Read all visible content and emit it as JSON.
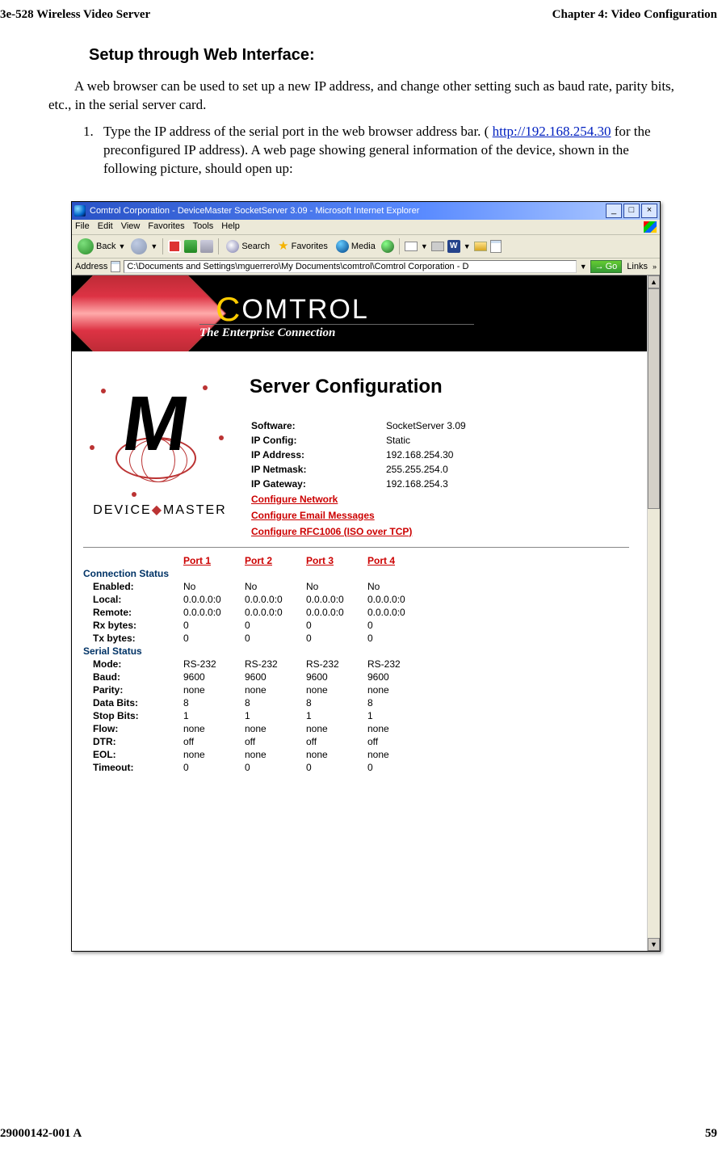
{
  "page_header": {
    "left": "3e-528 Wireless Video Server",
    "right": "Chapter 4: Video Configuration"
  },
  "section_heading": "Setup through Web Interface:",
  "intro_para": "A web browser can be used to set up a new IP address, and change other setting such as baud rate, parity bits, etc., in the serial server card.",
  "step_pre": "Type the IP address of the serial port in the web browser address bar. ( ",
  "step_link": "http://192.168.254.30",
  "step_post": " for the preconfigured IP address). A web page showing general information of the device, shown in the following picture, should open up:",
  "ie": {
    "title": "Comtrol Corporation - DeviceMaster SocketServer 3.09 - Microsoft Internet Explorer",
    "min": "_",
    "max": "□",
    "close": "×",
    "menu": [
      "File",
      "Edit",
      "View",
      "Favorites",
      "Tools",
      "Help"
    ],
    "back": "Back",
    "search": "Search",
    "favorites": "Favorites",
    "media": "Media",
    "addr_label": "Address",
    "addr_value": "C:\\Documents and Settings\\mguerrero\\My Documents\\comtrol\\Comtrol Corporation - D",
    "go": "Go",
    "links": "Links"
  },
  "banner": {
    "brand_c": "C",
    "brand_rest": "OMTROL",
    "tagline": "The Enterprise Connection"
  },
  "logo_text_1": "DEV",
  "logo_text_2": "CE",
  "logo_text_3": "MASTER",
  "cfg": {
    "title": "Server Configuration",
    "rows": [
      {
        "label": "Software:",
        "value": "SocketServer 3.09"
      },
      {
        "label": "IP Config:",
        "value": "Static"
      },
      {
        "label": "IP Address:",
        "value": "192.168.254.30"
      },
      {
        "label": "IP Netmask:",
        "value": "255.255.254.0"
      },
      {
        "label": "IP Gateway:",
        "value": "192.168.254.3"
      }
    ],
    "links": [
      "Configure Network",
      "Configure Email Messages",
      "Configure RFC1006 (ISO over TCP)"
    ]
  },
  "status": {
    "port_headers": [
      "Port 1",
      "Port 2",
      "Port 3",
      "Port 4"
    ],
    "conn_section": "Connection Status",
    "serial_section": "Serial Status",
    "rows": [
      {
        "section": "conn",
        "label": "Enabled:",
        "v": [
          "No",
          "No",
          "No",
          "No"
        ]
      },
      {
        "section": "conn",
        "label": "Local:",
        "v": [
          "0.0.0.0:0",
          "0.0.0.0:0",
          "0.0.0.0:0",
          "0.0.0.0:0"
        ]
      },
      {
        "section": "conn",
        "label": "Remote:",
        "v": [
          "0.0.0.0:0",
          "0.0.0.0:0",
          "0.0.0.0:0",
          "0.0.0.0:0"
        ]
      },
      {
        "section": "conn",
        "label": "Rx bytes:",
        "v": [
          "0",
          "0",
          "0",
          "0"
        ]
      },
      {
        "section": "conn",
        "label": "Tx bytes:",
        "v": [
          "0",
          "0",
          "0",
          "0"
        ]
      },
      {
        "section": "serial",
        "label": "Mode:",
        "v": [
          "RS-232",
          "RS-232",
          "RS-232",
          "RS-232"
        ]
      },
      {
        "section": "serial",
        "label": "Baud:",
        "v": [
          "9600",
          "9600",
          "9600",
          "9600"
        ]
      },
      {
        "section": "serial",
        "label": "Parity:",
        "v": [
          "none",
          "none",
          "none",
          "none"
        ]
      },
      {
        "section": "serial",
        "label": "Data Bits:",
        "v": [
          "8",
          "8",
          "8",
          "8"
        ]
      },
      {
        "section": "serial",
        "label": "Stop Bits:",
        "v": [
          "1",
          "1",
          "1",
          "1"
        ]
      },
      {
        "section": "serial",
        "label": "Flow:",
        "v": [
          "none",
          "none",
          "none",
          "none"
        ]
      },
      {
        "section": "serial",
        "label": "DTR:",
        "v": [
          "off",
          "off",
          "off",
          "off"
        ]
      },
      {
        "section": "serial",
        "label": "EOL:",
        "v": [
          "none",
          "none",
          "none",
          "none"
        ]
      },
      {
        "section": "serial",
        "label": "Timeout:",
        "v": [
          "0",
          "0",
          "0",
          "0"
        ]
      }
    ]
  },
  "footer": {
    "left": "29000142-001 A",
    "right": "59"
  }
}
